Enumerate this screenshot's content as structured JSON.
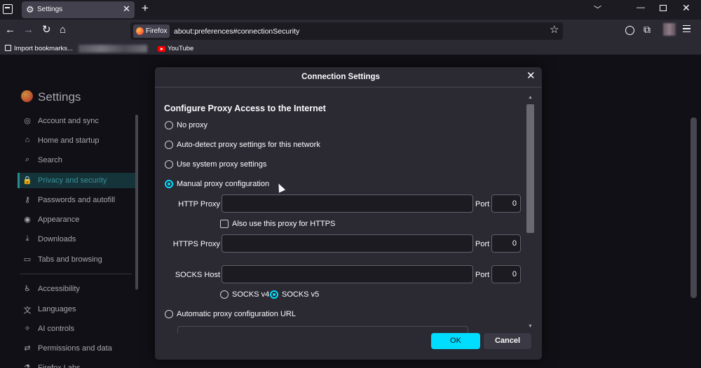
{
  "tabs": [
    {
      "title": "Settings"
    }
  ],
  "navbar": {
    "identity_label": "Firefox",
    "url": "about:preferences#connectionSecurity"
  },
  "bookmarks": [
    {
      "label": "Import bookmarks..."
    },
    {
      "label": "YouTube"
    }
  ],
  "settings": {
    "title": "Settings",
    "sidebar": [
      {
        "label": "Account and sync",
        "icon": "account-icon"
      },
      {
        "label": "Home and startup",
        "icon": "home-icon"
      },
      {
        "label": "Search",
        "icon": "search-icon"
      },
      {
        "label": "Privacy and security",
        "icon": "lock-icon",
        "active": true
      },
      {
        "label": "Passwords and autofill",
        "icon": "key-icon"
      },
      {
        "label": "Appearance",
        "icon": "eye-icon"
      },
      {
        "label": "Downloads",
        "icon": "download-icon"
      },
      {
        "label": "Tabs and browsing",
        "icon": "tabs-icon"
      },
      {
        "label": "Accessibility",
        "icon": "accessibility-icon"
      },
      {
        "label": "Languages",
        "icon": "languages-icon"
      },
      {
        "label": "AI controls",
        "icon": "sparkle-icon"
      },
      {
        "label": "Permissions and data",
        "icon": "permissions-icon"
      },
      {
        "label": "Firefox Labs",
        "icon": "flask-icon"
      }
    ]
  },
  "dialog": {
    "title": "Connection Settings",
    "heading": "Configure Proxy Access to the Internet",
    "options": {
      "no_proxy": "No proxy",
      "auto_detect": "Auto-detect proxy settings for this network",
      "system": "Use system proxy settings",
      "manual": "Manual proxy configuration",
      "auto_url": "Automatic proxy configuration URL"
    },
    "selected_option": "manual",
    "http_proxy": {
      "label": "HTTP Proxy",
      "value": "",
      "port_label": "Port",
      "port": "0"
    },
    "also_https": {
      "label": "Also use this proxy for HTTPS",
      "checked": false
    },
    "https_proxy": {
      "label": "HTTPS Proxy",
      "value": "",
      "port_label": "Port",
      "port": "0"
    },
    "socks_host": {
      "label": "SOCKS Host",
      "value": "",
      "port_label": "Port",
      "port": "0"
    },
    "socks_v4": "SOCKS v4",
    "socks_v5": "SOCKS v5",
    "socks_selected": "v5",
    "ok": "OK",
    "cancel": "Cancel"
  },
  "colors": {
    "accent": "#00ddff",
    "background": "#2b2a33",
    "page": "#1c1b22"
  }
}
